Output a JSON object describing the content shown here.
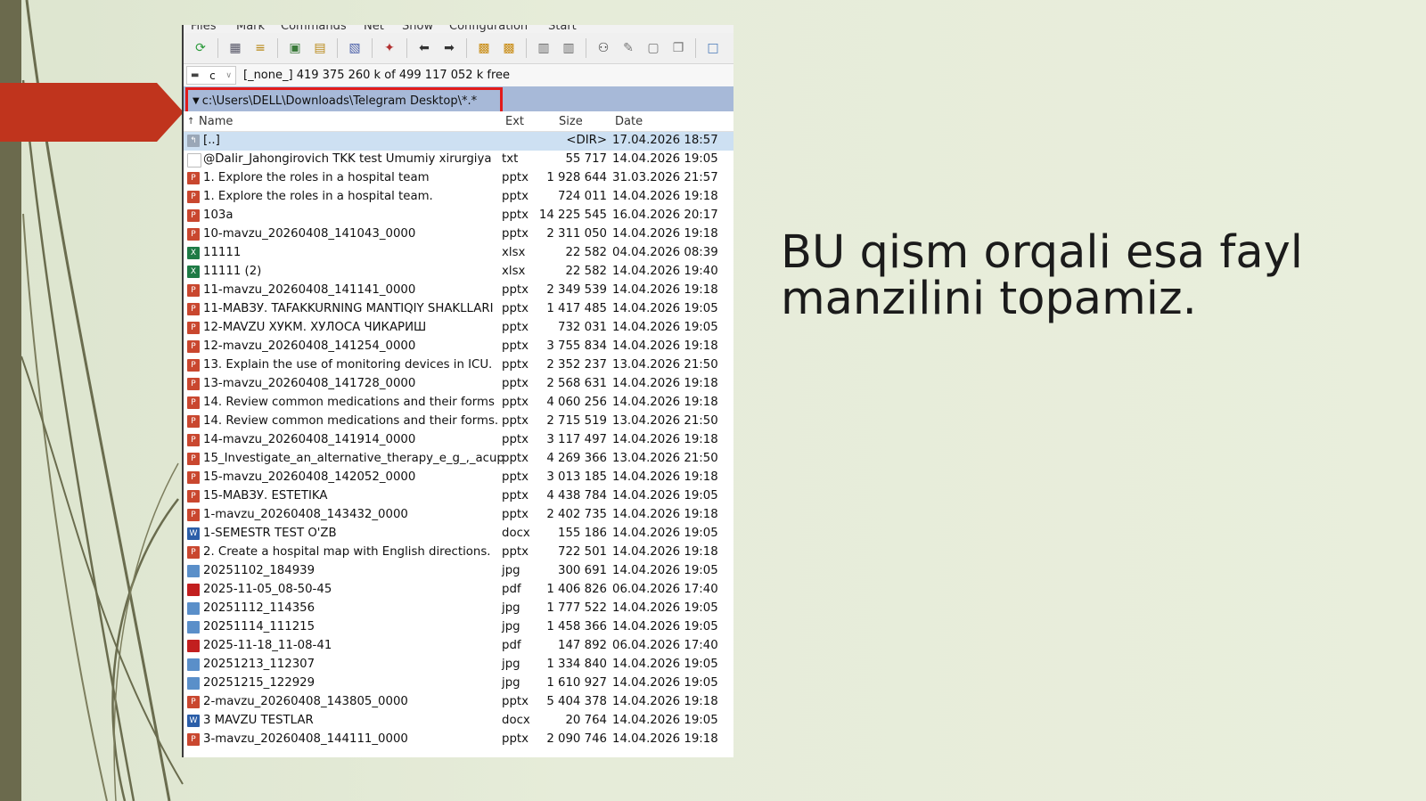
{
  "menu": [
    "Files",
    "Mark",
    "Commands",
    "Net",
    "Show",
    "Configuration",
    "Start"
  ],
  "drive": {
    "letter": "c",
    "info": "[_none_]  419 375 260 k of 499 117 052 k free"
  },
  "path": "c:\\Users\\DELL\\Downloads\\Telegram Desktop\\*.*",
  "columns": {
    "name": "Name",
    "ext": "Ext",
    "size": "Size",
    "date": "Date"
  },
  "files": [
    {
      "name": "[..]",
      "ext": "",
      "size": "<DIR>",
      "date": "17.04.2026 18:57",
      "type": "up"
    },
    {
      "name": "@Dalir_Jahongirovich TKK test Umumiy xirurgiya",
      "ext": "txt",
      "size": "55 717",
      "date": "14.04.2026 19:05",
      "type": "txt"
    },
    {
      "name": "1. Explore the roles in a hospital team",
      "ext": "pptx",
      "size": "1 928 644",
      "date": "31.03.2026 21:57",
      "type": "pptx"
    },
    {
      "name": "1. Explore the roles in a hospital team.",
      "ext": "pptx",
      "size": "724 011",
      "date": "14.04.2026 19:18",
      "type": "pptx"
    },
    {
      "name": "103a",
      "ext": "pptx",
      "size": "14 225 545",
      "date": "16.04.2026 20:17",
      "type": "pptx"
    },
    {
      "name": "10-mavzu_20260408_141043_0000",
      "ext": "pptx",
      "size": "2 311 050",
      "date": "14.04.2026 19:18",
      "type": "pptx"
    },
    {
      "name": "11111",
      "ext": "xlsx",
      "size": "22 582",
      "date": "04.04.2026 08:39",
      "type": "xlsx"
    },
    {
      "name": "11111 (2)",
      "ext": "xlsx",
      "size": "22 582",
      "date": "14.04.2026 19:40",
      "type": "xlsx"
    },
    {
      "name": "11-mavzu_20260408_141141_0000",
      "ext": "pptx",
      "size": "2 349 539",
      "date": "14.04.2026 19:18",
      "type": "pptx"
    },
    {
      "name": "11-МАВЗУ. TAFAKKURNING MANTIQIY SHAKLLARI",
      "ext": "pptx",
      "size": "1 417 485",
      "date": "14.04.2026 19:05",
      "type": "pptx"
    },
    {
      "name": "12-MAVZU ХУКМ. ХУЛОСА ЧИКАРИШ",
      "ext": "pptx",
      "size": "732 031",
      "date": "14.04.2026 19:05",
      "type": "pptx"
    },
    {
      "name": "12-mavzu_20260408_141254_0000",
      "ext": "pptx",
      "size": "3 755 834",
      "date": "14.04.2026 19:18",
      "type": "pptx"
    },
    {
      "name": "13. Explain the use of monitoring devices in ICU.",
      "ext": "pptx",
      "size": "2 352 237",
      "date": "13.04.2026 21:50",
      "type": "pptx"
    },
    {
      "name": "13-mavzu_20260408_141728_0000",
      "ext": "pptx",
      "size": "2 568 631",
      "date": "14.04.2026 19:18",
      "type": "pptx"
    },
    {
      "name": "14. Review common medications and their forms",
      "ext": "pptx",
      "size": "4 060 256",
      "date": "14.04.2026 19:18",
      "type": "pptx"
    },
    {
      "name": "14. Review common medications and their forms.",
      "ext": "pptx",
      "size": "2 715 519",
      "date": "13.04.2026 21:50",
      "type": "pptx"
    },
    {
      "name": "14-mavzu_20260408_141914_0000",
      "ext": "pptx",
      "size": "3 117 497",
      "date": "14.04.2026 19:18",
      "type": "pptx"
    },
    {
      "name": "15_Investigate_an_alternative_therapy_e_g_,_acupu..",
      "ext": "pptx",
      "size": "4 269 366",
      "date": "13.04.2026 21:50",
      "type": "pptx"
    },
    {
      "name": "15-mavzu_20260408_142052_0000",
      "ext": "pptx",
      "size": "3 013 185",
      "date": "14.04.2026 19:18",
      "type": "pptx"
    },
    {
      "name": "15-МАВЗУ. ESTETIKA",
      "ext": "pptx",
      "size": "4 438 784",
      "date": "14.04.2026 19:05",
      "type": "pptx"
    },
    {
      "name": "1-mavzu_20260408_143432_0000",
      "ext": "pptx",
      "size": "2 402 735",
      "date": "14.04.2026 19:18",
      "type": "pptx"
    },
    {
      "name": "1-SEMESTR TEST O'ZB",
      "ext": "docx",
      "size": "155 186",
      "date": "14.04.2026 19:05",
      "type": "docx"
    },
    {
      "name": "2. Create a hospital map with English directions.",
      "ext": "pptx",
      "size": "722 501",
      "date": "14.04.2026 19:18",
      "type": "pptx"
    },
    {
      "name": "20251102_184939",
      "ext": "jpg",
      "size": "300 691",
      "date": "14.04.2026 19:05",
      "type": "jpg"
    },
    {
      "name": "2025-11-05_08-50-45",
      "ext": "pdf",
      "size": "1 406 826",
      "date": "06.04.2026 17:40",
      "type": "pdf"
    },
    {
      "name": "20251112_114356",
      "ext": "jpg",
      "size": "1 777 522",
      "date": "14.04.2026 19:05",
      "type": "jpg"
    },
    {
      "name": "20251114_111215",
      "ext": "jpg",
      "size": "1 458 366",
      "date": "14.04.2026 19:05",
      "type": "jpg"
    },
    {
      "name": "2025-11-18_11-08-41",
      "ext": "pdf",
      "size": "147 892",
      "date": "06.04.2026 17:40",
      "type": "pdf"
    },
    {
      "name": "20251213_112307",
      "ext": "jpg",
      "size": "1 334 840",
      "date": "14.04.2026 19:05",
      "type": "jpg"
    },
    {
      "name": "20251215_122929",
      "ext": "jpg",
      "size": "1 610 927",
      "date": "14.04.2026 19:05",
      "type": "jpg"
    },
    {
      "name": "2-mavzu_20260408_143805_0000",
      "ext": "pptx",
      "size": "5 404 378",
      "date": "14.04.2026 19:18",
      "type": "pptx"
    },
    {
      "name": "3 MAVZU TESTLAR",
      "ext": "docx",
      "size": "20 764",
      "date": "14.04.2026 19:05",
      "type": "docx"
    },
    {
      "name": "3-mavzu_20260408_144111_0000",
      "ext": "pptx",
      "size": "2 090 746",
      "date": "14.04.2026 19:18",
      "type": "pptx"
    }
  ],
  "note": "BU qism orqali esa fayl manzilini topamiz.",
  "colors": {
    "selection": "#cde0f2",
    "pathbar": "#a7b9d8",
    "highlight_box": "#e21b1b",
    "arrow": "#c0341d",
    "pptx_icon": "#c9472f",
    "xlsx_icon": "#1e7a45",
    "docx_icon": "#2b5ea8",
    "jpg_icon": "#5a8fc9",
    "pdf_icon": "#c21f1f"
  }
}
